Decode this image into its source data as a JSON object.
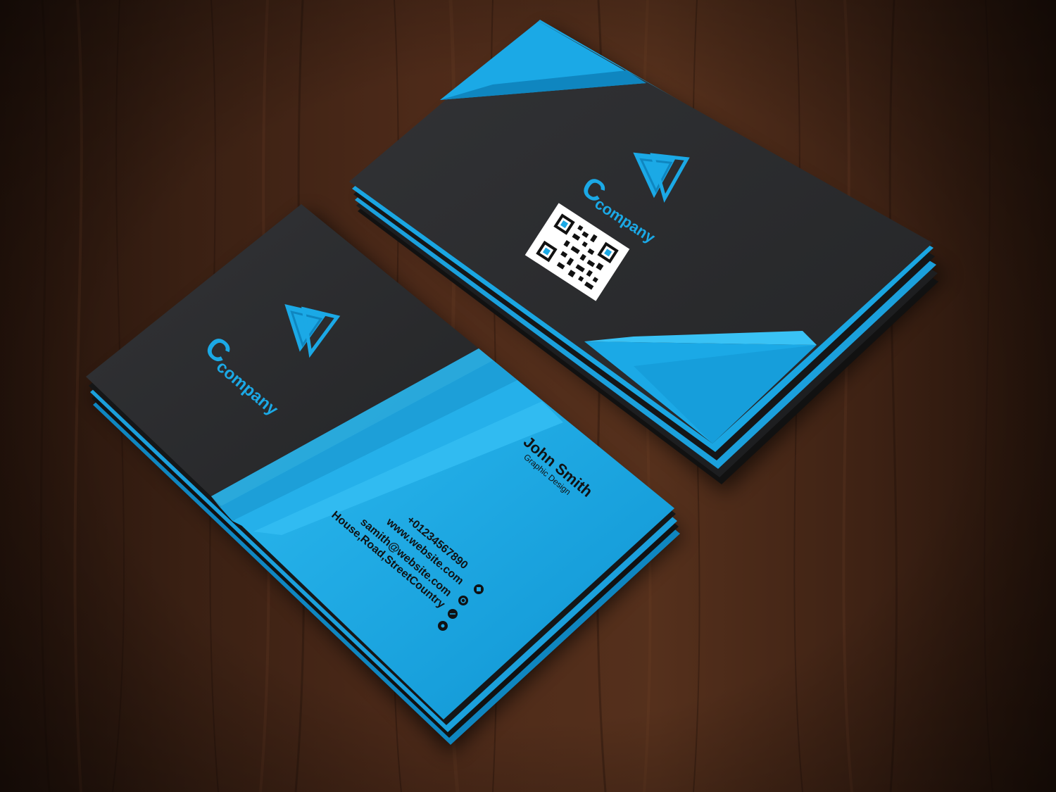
{
  "colors": {
    "wood_dark": "#2a160d",
    "wood_mid": "#4a2818",
    "wood_light": "#5e3420",
    "card_dark": "#2b2c2e",
    "card_edge": "#151617",
    "accent_blue": "#1ba9e6",
    "accent_blue_dark": "#0f86c0",
    "accent_blue_light": "#39c2f5",
    "text_dark": "#101214",
    "qr_white": "#ffffff"
  },
  "front_card": {
    "logo_letter": "C",
    "company": "company",
    "name": "John Smith",
    "title": "Graphic Design",
    "phone": "+01234567890",
    "website": "www.website.com",
    "email": "samith@website.com",
    "address": "House,Road,StreetCountry",
    "icons": [
      "phone-icon",
      "globe-icon",
      "at-icon",
      "location-pin-icon"
    ]
  },
  "back_card": {
    "logo_letter": "C",
    "company": "company",
    "qr_code": "qr-code-icon"
  }
}
